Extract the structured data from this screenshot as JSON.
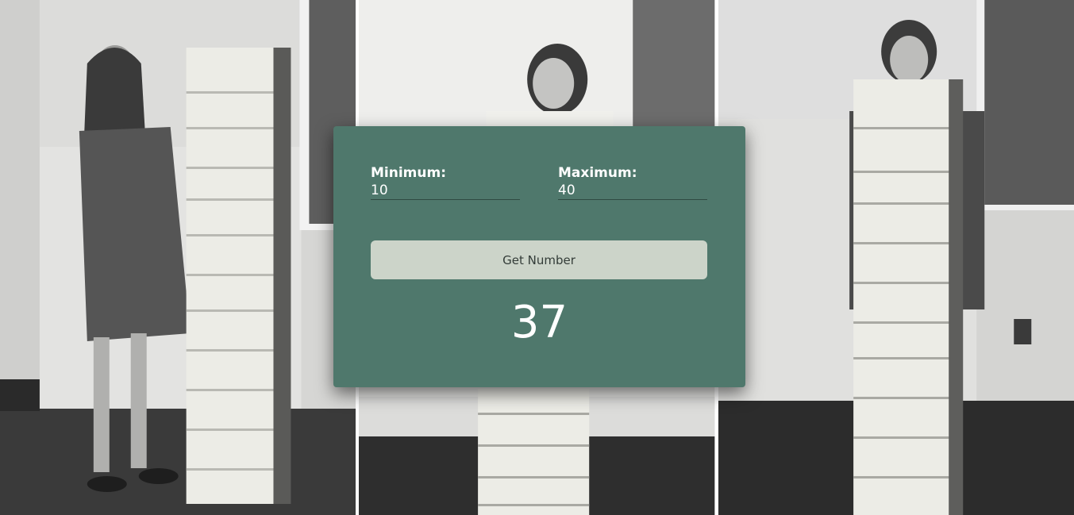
{
  "form": {
    "min_label": "Minimum:",
    "min_value": "10",
    "max_label": "Maximum:",
    "max_value": "40",
    "button_label": "Get Number",
    "result": "37"
  },
  "colors": {
    "card_background": "#4f786c",
    "button_background": "#ccd4c9",
    "text": "#ffffff"
  }
}
